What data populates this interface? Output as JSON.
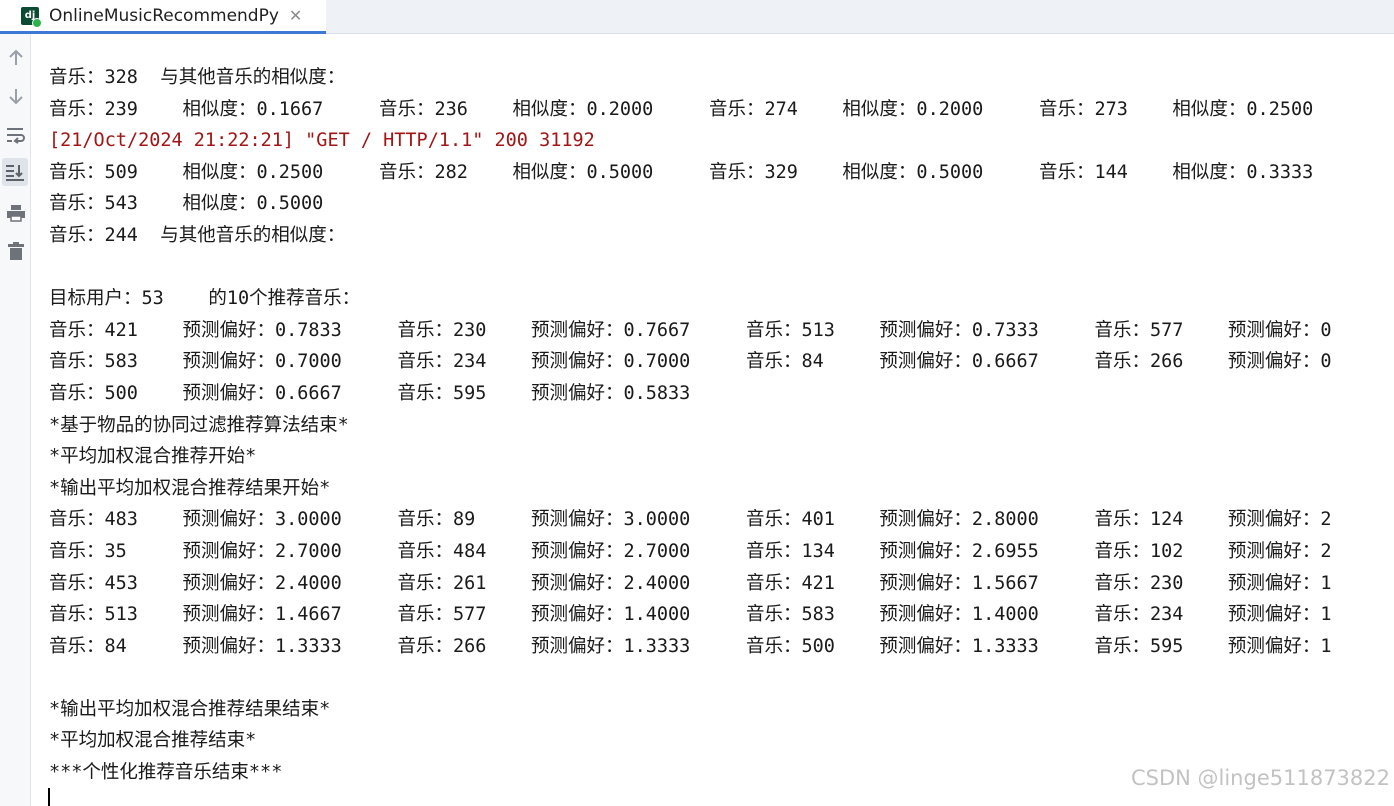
{
  "tab": {
    "title": "OnlineMusicRecommendPy",
    "logo_text": "dj",
    "close_glyph": "✕"
  },
  "toolbar": {
    "icons": [
      "arrow-up-icon",
      "arrow-down-icon",
      "soft-wrap-icon",
      "scroll-to-end-icon",
      "print-icon",
      "trash-icon"
    ]
  },
  "console": {
    "lines": [
      "音乐：328  与其他音乐的相似度：",
      "音乐：239    相似度：0.1667     音乐：236    相似度：0.2000     音乐：274    相似度：0.2000     音乐：273    相似度：0.2500",
      "[21/Oct/2024 21:22:21] \"GET / HTTP/1.1\" 200 31192",
      "音乐：509    相似度：0.2500     音乐：282    相似度：0.5000     音乐：329    相似度：0.5000     音乐：144    相似度：0.3333",
      "音乐：543    相似度：0.5000",
      "音乐：244  与其他音乐的相似度：",
      "",
      "目标用户：53    的10个推荐音乐：",
      "音乐：421    预测偏好：0.7833     音乐：230    预测偏好：0.7667     音乐：513    预测偏好：0.7333     音乐：577    预测偏好：0",
      "音乐：583    预测偏好：0.7000     音乐：234    预测偏好：0.7000     音乐：84     预测偏好：0.6667     音乐：266    预测偏好：0",
      "音乐：500    预测偏好：0.6667     音乐：595    预测偏好：0.5833",
      "*基于物品的协同过滤推荐算法结束*",
      "*平均加权混合推荐开始*",
      "*输出平均加权混合推荐结果开始*",
      "音乐：483    预测偏好：3.0000     音乐：89     预测偏好：3.0000     音乐：401    预测偏好：2.8000     音乐：124    预测偏好：2",
      "音乐：35     预测偏好：2.7000     音乐：484    预测偏好：2.7000     音乐：134    预测偏好：2.6955     音乐：102    预测偏好：2",
      "音乐：453    预测偏好：2.4000     音乐：261    预测偏好：2.4000     音乐：421    预测偏好：1.5667     音乐：230    预测偏好：1",
      "音乐：513    预测偏好：1.4667     音乐：577    预测偏好：1.4000     音乐：583    预测偏好：1.4000     音乐：234    预测偏好：1",
      "音乐：84     预测偏好：1.3333     音乐：266    预测偏好：1.3333     音乐：500    预测偏好：1.3333     音乐：595    预测偏好：1",
      "",
      "*输出平均加权混合推荐结果结束*",
      "*平均加权混合推荐结束*",
      "***个性化推荐音乐结束***"
    ]
  },
  "watermark": "CSDN @linge511873822",
  "colors": {
    "accent": "#3b79d4",
    "error_text": "#a31515",
    "django_green": "#0c4b33"
  }
}
